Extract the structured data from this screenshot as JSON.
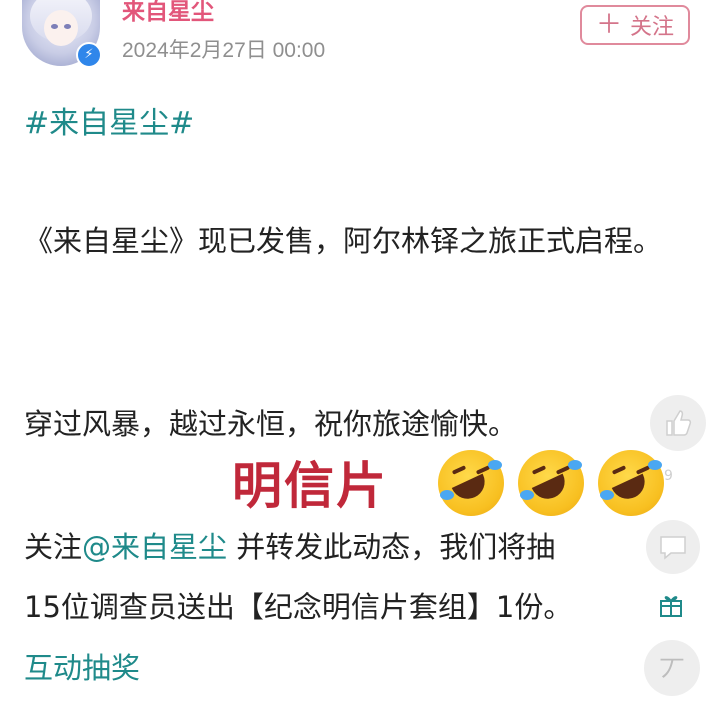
{
  "author": {
    "name": "来自星尘",
    "timestamp": "2024年2月27日 00:00",
    "verified_icon": "lightning-badge-icon"
  },
  "follow_button": {
    "plus": "＋",
    "label": "关注"
  },
  "post": {
    "topic": "#来自星尘#",
    "paragraph1": "《来自星尘》现已发售，阿尔林铎之旅正式启程。",
    "paragraph2": "穿过风暴，越过永恒，祝你旅途愉快。",
    "line3_prefix": "关注",
    "line3_mention": "@来自星尘",
    "line3_suffix": " 并转发此动态，我们将抽",
    "line4": "15位调查员送出【纪念明信片套组】1份。",
    "lottery_link": "互动抽奖"
  },
  "overlay": {
    "label": "明信片",
    "emoji_icon": "rolling-on-floor-laughing-icon"
  },
  "side_actions": {
    "like_count": "9",
    "top_icon": "丆"
  },
  "colors": {
    "author": "#e2567a",
    "link": "#1f8a8a",
    "overlay_text": "#c0283a",
    "follow_border": "#e08a9c"
  }
}
